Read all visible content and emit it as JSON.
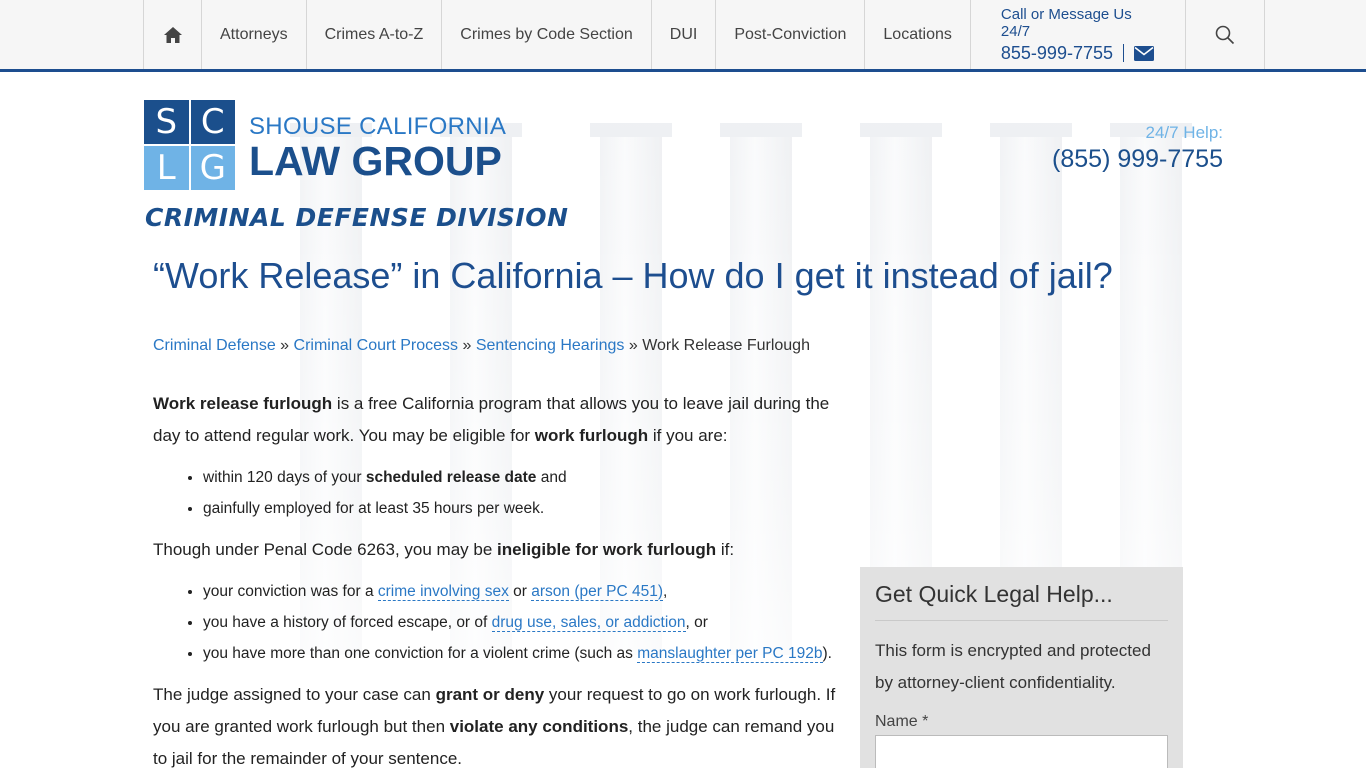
{
  "nav": {
    "home_icon": "home-icon",
    "items": [
      "Attorneys",
      "Crimes A-to-Z",
      "Crimes by Code Section",
      "DUI",
      "Post-Conviction",
      "Locations"
    ],
    "contact_label": "Call or Message Us 24/7",
    "contact_phone": "855-999-7755",
    "mail_icon": "envelope-icon",
    "search_icon": "search-icon"
  },
  "logo": {
    "letters": [
      "S",
      "C",
      "L",
      "G"
    ],
    "line1": "SHOUSE CALIFORNIA",
    "line2": "LAW GROUP",
    "division": "CRIMINAL DEFENSE DIVISION"
  },
  "help": {
    "label": "24/7 Help:",
    "phone": "(855) 999-7755"
  },
  "page": {
    "title": "“Work Release” in California – How do I get it instead of jail?",
    "breadcrumbs": [
      "Criminal Defense",
      "Criminal Court Process",
      "Sentencing Hearings"
    ],
    "breadcrumb_current": "Work Release Furlough",
    "breadcrumb_sep": "»"
  },
  "content": {
    "p1_b1": "Work release furlough",
    "p1_t1": " is a free California program that allows you to leave jail during the day to attend regular work. You may be eligible for ",
    "p1_b2": "work furlough",
    "p1_t2": " if you are:",
    "list1_a_t1": "within 120 days of your ",
    "list1_a_b": "scheduled release date",
    "list1_a_t2": " and",
    "list1_b": "gainfully employed for at least 35 hours per week.",
    "p2_t1": "Though under Penal Code 6263, you may be ",
    "p2_b": "ineligible for work furlough",
    "p2_t2": " if:",
    "l2a_t1": "your conviction was for a ",
    "l2a_link1": "crime involving sex",
    "l2a_t2": " or ",
    "l2a_link2": "arson (per PC 451)",
    "l2a_t3": ",",
    "l2b_t1": "you have a history of forced escape, or of ",
    "l2b_link": "drug use, sales, or addiction",
    "l2b_t2": ", or",
    "l2c_t1": "you have more than one conviction for a violent crime (such as ",
    "l2c_link": "manslaughter per PC 192b",
    "l2c_t2": ").",
    "p3_t1": "The judge assigned to your case can ",
    "p3_b1": "grant or deny",
    "p3_t2": " your request to go on work furlough. If you are granted work furlough but then ",
    "p3_b2": "violate any conditions",
    "p3_t3": ", the judge can remand you to jail for the remainder of your sentence."
  },
  "sidebar": {
    "title": "Get Quick Legal Help...",
    "note": "This form is encrypted and protected by attorney-client confidentiality.",
    "name_label": "Name *"
  }
}
